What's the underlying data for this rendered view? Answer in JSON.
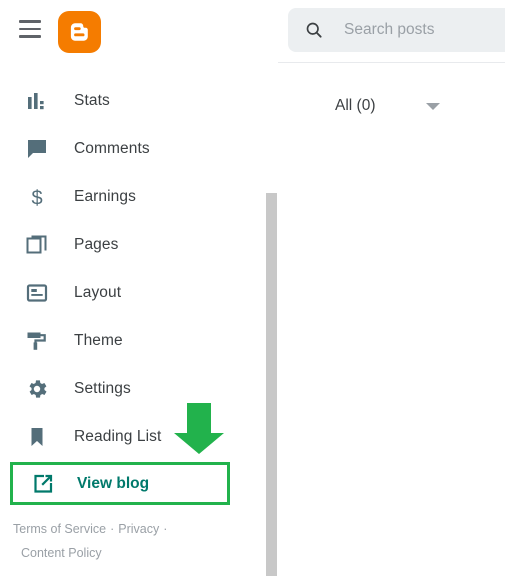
{
  "app": {
    "name": "Blogger",
    "logo_icon": "blogger-logo-icon",
    "menu_icon": "hamburger-menu-icon"
  },
  "search": {
    "icon": "search-icon",
    "placeholder": "Search posts",
    "value": ""
  },
  "sidebar": {
    "items": [
      {
        "label": "Stats",
        "icon": "bar-chart-icon"
      },
      {
        "label": "Comments",
        "icon": "comment-bubble-icon"
      },
      {
        "label": "Earnings",
        "icon": "dollar-sign-icon"
      },
      {
        "label": "Pages",
        "icon": "pages-stack-icon"
      },
      {
        "label": "Layout",
        "icon": "layout-icon"
      },
      {
        "label": "Theme",
        "icon": "paint-roller-icon"
      },
      {
        "label": "Settings",
        "icon": "gear-icon"
      },
      {
        "label": "Reading List",
        "icon": "bookmark-icon"
      }
    ],
    "view_blog": {
      "label": "View blog",
      "icon": "open-in-new-icon",
      "text_color": "#00796b",
      "highlighted": true,
      "highlight_color": "#22b24c"
    },
    "footer": {
      "terms": "Terms of Service",
      "separator_1": "·",
      "privacy": "Privacy",
      "separator_2": "·",
      "content_policy": "Content Policy"
    }
  },
  "main": {
    "filter": {
      "label": "All (0)",
      "caret_icon": "chevron-down-icon"
    }
  },
  "annotation": {
    "arrow_icon": "down-arrow-annotation",
    "color": "#22b24c"
  },
  "scrollbar": {
    "thumb_color": "#c8c8c8"
  },
  "colors": {
    "brand_orange": "#f57c00",
    "icon_slate": "#546e7a",
    "text": "#3c4043",
    "muted": "#9aa0a6",
    "teal": "#00796b",
    "annotation_green": "#22b24c"
  }
}
